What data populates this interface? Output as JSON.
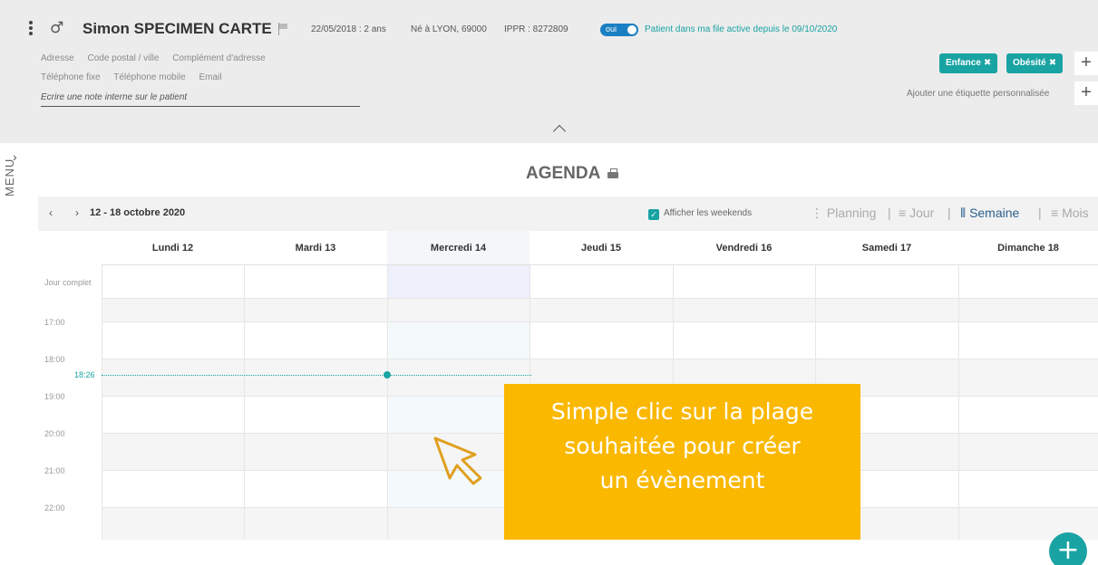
{
  "patient": {
    "name": "Simon SPECIMEN CARTE",
    "birth": "22/05/2018 : 2 ans",
    "born_place": "Né à LYON, 69000",
    "ippr": "IPPR : 8272809",
    "toggle_label": "oui",
    "active_text": "Patient dans ma file active depuis le 09/10/2020",
    "gender_icon": "male-icon"
  },
  "address_fields": [
    "Adresse",
    "Code postal / ville",
    "Complément d'adresse"
  ],
  "contact_fields": [
    "Téléphone fixe",
    "Téléphone mobile",
    "Email"
  ],
  "note_placeholder": "Ecrire une note interne sur le patient",
  "tags": [
    {
      "label": "Enfance",
      "close": "✖"
    },
    {
      "label": "Obésité",
      "close": "✖"
    }
  ],
  "add_tag_symbol": "+",
  "add_custom_label": "Ajouter une étiquette personnalisée",
  "sidebar": {
    "menu_label": "MENU",
    "chevron": "›"
  },
  "agenda": {
    "title": "AGENDA",
    "prev": "‹",
    "next": "›",
    "range": "12 - 18 octobre 2020",
    "show_weekends": "Afficher les weekends",
    "views": [
      {
        "icon": "⋮",
        "label": "Planning"
      },
      {
        "icon": "≡",
        "label": "Jour"
      },
      {
        "icon": "⦀",
        "label": "Semaine"
      },
      {
        "icon": "≡",
        "label": "Mois"
      }
    ],
    "separator": "|",
    "days": [
      "Lundi 12",
      "Mardi 13",
      "Mercredi 14",
      "Jeudi 15",
      "Vendredi 16",
      "Samedi 17",
      "Dimanche 18"
    ],
    "allday_label": "Jour complet",
    "hours": [
      "17:00",
      "18:00",
      "19:00",
      "20:00",
      "21:00",
      "22:00"
    ],
    "now_label": "18:26"
  },
  "callout": {
    "line1": "Simple clic sur la plage",
    "line2": "souhaitée pour créer",
    "line3": "un évènement"
  },
  "fab_symbol": "+",
  "colors": {
    "accent": "#1aa3a3",
    "callout": "#fbb800",
    "toggle": "#1a7fc2"
  }
}
